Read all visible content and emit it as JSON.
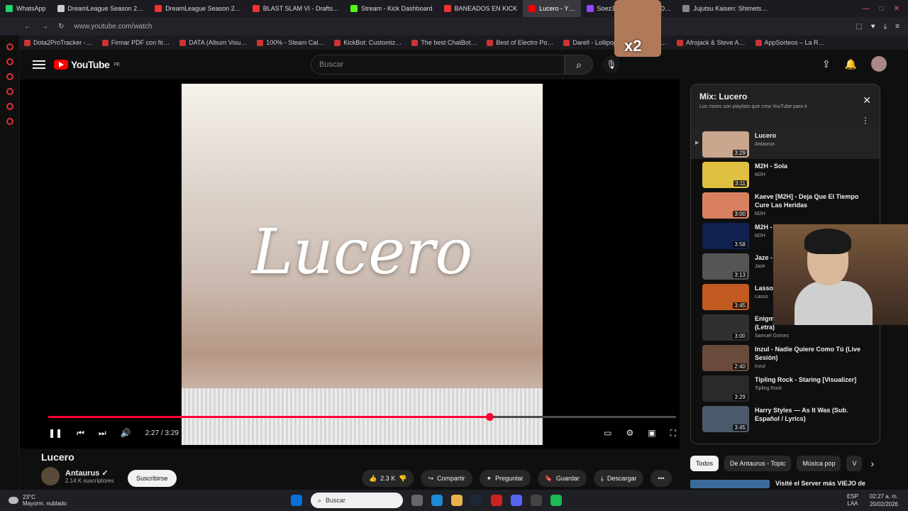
{
  "browser": {
    "tabs": [
      {
        "label": "WhatsApp",
        "color": "#25d366"
      },
      {
        "label": "DreamLeague Season 2…",
        "color": "#cccccc"
      },
      {
        "label": "DreamLeague Season 2…",
        "color": "#e33"
      },
      {
        "label": "BLAST SLAM VI - Drafts…",
        "color": "#e33"
      },
      {
        "label": "Stream - Kick Dashboard",
        "color": "#53fc18"
      },
      {
        "label": "BANEADOS EN KICK",
        "color": "#e33"
      },
      {
        "label": "Lucero - Y…",
        "color": "#f00"
      },
      {
        "label": "Soez3 - Watch the VOD…",
        "color": "#9146ff"
      },
      {
        "label": "Jujutsu Kaisen: Shimets…",
        "color": "#888"
      }
    ],
    "active_tab": "Lucero - Y…",
    "url": "www.youtube.com/watch",
    "bookmarks": [
      "Dota2ProTracker -…",
      "Firmar PDF con fir…",
      "DATA (Album Visu…",
      "100% - Steam Cal…",
      "KickBot: Customiz…",
      "The best ChatBot…",
      "Best of Electro Po…",
      "Darell - Lollipop (…",
      "…tor…",
      "Afrojack & Steve A…",
      "AppSorteos – La R…"
    ]
  },
  "header": {
    "logo_text": "YouTube",
    "logo_region": "PE",
    "search_placeholder": "Buscar"
  },
  "player": {
    "overlay_title": "Lucero",
    "time": "2:27 / 3:29",
    "progress_fraction": 0.703
  },
  "video": {
    "title": "Lucero",
    "channel": "Antaurus",
    "subscribers": "2.14 K suscriptores",
    "subscribe_label": "Suscribirse",
    "likes": "2.3 K",
    "share_label": "Compartir",
    "ask_label": "Preguntar",
    "save_label": "Guardar",
    "download_label": "Descargar"
  },
  "playlist": {
    "title": "Mix: Lucero",
    "subtitle": "Los mixes son playlists que crea YouTube para ti",
    "items": [
      {
        "title": "Lucero",
        "artist": "Antaurus",
        "duration": "3:29",
        "color": "#c9a78f"
      },
      {
        "title": "M2H - Sola",
        "artist": "M2H",
        "duration": "3:11",
        "color": "#e0c040"
      },
      {
        "title": "Kaeve [M2H] - Deja Que El Tiempo Cure Las Heridas",
        "artist": "M2H",
        "duration": "3:00",
        "color": "#d98060"
      },
      {
        "title": "M2H -",
        "artist": "M2H",
        "duration": "3:58",
        "color": "#102050"
      },
      {
        "title": "Jaze - [QNEP",
        "artist": "Jaze",
        "duration": "3:13",
        "color": "#555555"
      },
      {
        "title": "Lasso Oficial",
        "artist": "Lasso",
        "duration": "3:45",
        "color": "#c05a20"
      },
      {
        "title": "Enigmática - Maldito Antisocial (Letra)",
        "artist": "Samuel Gomez",
        "duration": "3:00",
        "color": "#303030"
      },
      {
        "title": "Inzul - Nadie Quiere Como Tú (Live Sesión)",
        "artist": "Inzul",
        "duration": "2:40",
        "color": "#6a4a3a"
      },
      {
        "title": "Tipling Rock - Staring [Visualizer]",
        "artist": "Tipling Rock",
        "duration": "3:29",
        "color": "#2a2a2a"
      },
      {
        "title": "Harry Styles — As It Was (Sub. Español / Lyrics)",
        "artist": "",
        "duration": "3:45",
        "color": "#4a5a6a"
      }
    ]
  },
  "chips": [
    "Todos",
    "De Antaurus - Topic",
    "Música pop",
    "V"
  ],
  "next_video": "Visité el Server más VIEJO de",
  "emote_text": "x2",
  "taskbar": {
    "temp": "23°C",
    "weather": "Mayorm. nublado",
    "search": "Buscar",
    "lang": "ESP",
    "layout": "LAA",
    "time": "02:27 a. m.",
    "date": "20/02/2026"
  }
}
